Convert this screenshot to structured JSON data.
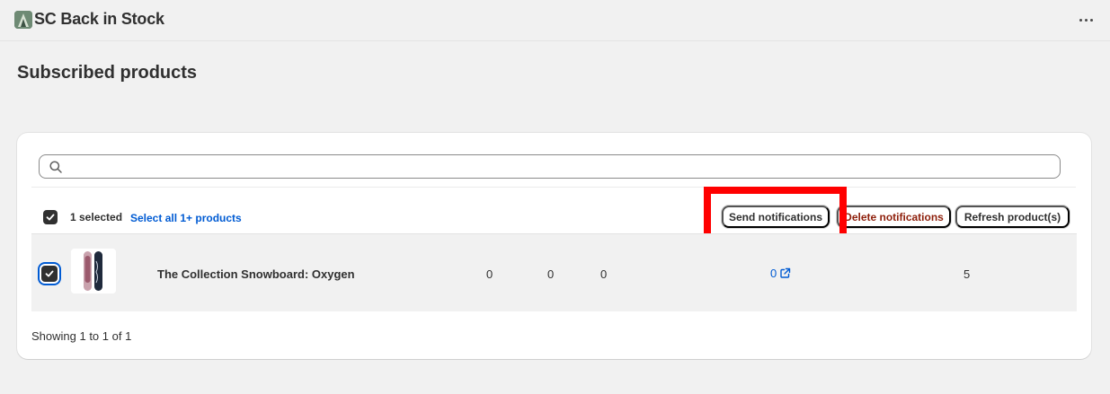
{
  "app": {
    "title": "SC Back in Stock"
  },
  "page": {
    "title": "Subscribed products"
  },
  "search": {
    "placeholder": "",
    "value": ""
  },
  "bulk": {
    "selected_label": "1 selected",
    "select_all_label": "Select all 1+ products",
    "send_label": "Send notifications",
    "delete_label": "Delete notifications",
    "refresh_label": "Refresh product(s)"
  },
  "rows": [
    {
      "product": "The Collection Snowboard: Oxygen",
      "col1": "0",
      "col2": "0",
      "col3": "0",
      "link_value": "0",
      "col5": "5",
      "checked": true
    }
  ],
  "footer": {
    "pagination": "Showing 1 to 1 of 1"
  },
  "colors": {
    "accent": "#005bd3",
    "danger": "#8e1f0b",
    "highlight": "#ff0000"
  },
  "icons": [
    "app-logo-icon",
    "more-horizontal-icon",
    "search-icon",
    "checkmark-icon",
    "external-link-icon"
  ]
}
